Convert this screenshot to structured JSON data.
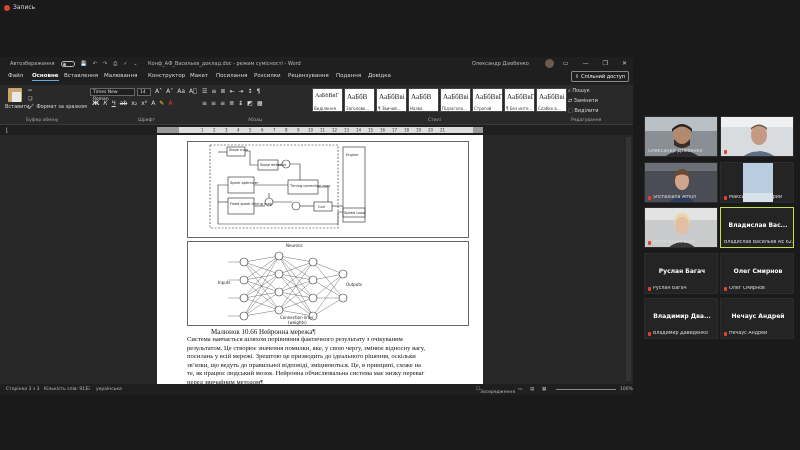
{
  "recording": {
    "label": "Запись"
  },
  "titlebar": {
    "autosave_label": "Автозбереження",
    "doc_title": "Конф_АФ_Васильєв_доклад.doc  -  режим сумісності  -  Word",
    "user": "Олександр Дзюбенко"
  },
  "tabs": [
    "Файл",
    "Основне",
    "Вставлення",
    "Малювання",
    "Конструктор",
    "Макет",
    "Посилання",
    "Розсилки",
    "Рецензування",
    "Подання",
    "Довідка"
  ],
  "active_tab": "Основне",
  "share_label": "Спільний доступ",
  "ribbon": {
    "paste_label": "Вставити",
    "format_painter": "Формат за зразком",
    "clipboard_group": "Буфер обміну",
    "font_name": "Times New Roman",
    "font_size": "14",
    "font_group": "Шрифт",
    "paragraph_group": "Абзац",
    "styles_group": "Стилі",
    "editing_group": "Редагування",
    "find": "Пошук",
    "replace": "Замінити",
    "select": "Виділити",
    "styles": [
      {
        "sample": "АаБбВвГ",
        "name": "Виділення"
      },
      {
        "sample": "АаБбВ",
        "name": "Заголово..."
      },
      {
        "sample": "АаБбВві",
        "name": "¶ Звичай..."
      },
      {
        "sample": "АаБбВ",
        "name": "Назва"
      },
      {
        "sample": "АаБбВві",
        "name": "Підзаголо..."
      },
      {
        "sample": "АаБбВвГ",
        "name": "Строгий"
      },
      {
        "sample": "АаБбВвГ",
        "name": "¶ Без инте..."
      },
      {
        "sample": "АаБбВві",
        "name": "Слабке в..."
      }
    ]
  },
  "figure2": {
    "neurons": "Neurons",
    "inputs": "Inputs",
    "outputs": "Outputs",
    "connection": "Connection lines",
    "weights": "(weights)"
  },
  "figure1": {
    "slope_map": "Slope map",
    "slope_detector": "Slope detector",
    "spark_map": "Spark optimizer",
    "fixed_spark": "Fixed spark timing map",
    "timing_map": "Timing correction map",
    "coil": "Coil",
    "engine": "Engine",
    "speed_load": "Speed Load"
  },
  "document": {
    "caption": "Малюнок 10.66 Нейронна мережа",
    "lines": [
      "     Система навчається шляхом порівняння фактичного результату з очікуваним",
      "результатом. Це створює значення помилки, яке, у свою чергу, змінює відносну вагу,",
      "посилань у всій мережі. Зрештою це призводить до ідеального рішення, оскільки",
      "зв’язки, що ведуть до правильної відповіді, зміцнюються. Це, в принципі, схоже на",
      "те, як працює людський мозок. Нейронна обчислювальна система має низку переваг",
      "перед звичайним методом"
    ]
  },
  "statusbar": {
    "page": "Сторінка 3 з 3",
    "words": "Кількість слів: 911",
    "language": "українська",
    "focus": "Зосередження",
    "zoom": "100%"
  },
  "participants": [
    {
      "name": "Олександр Дзюбенко",
      "muted": false,
      "video": true,
      "photo": "man-dark"
    },
    {
      "name": "ӘԹԿՃ ԶԽԾԲ ԹՔԽԽՃՆԽ",
      "muted": true,
      "video": true,
      "photo": "man-light"
    },
    {
      "name": "Shchasiana Arhuh",
      "muted": true,
      "video": true,
      "photo": "woman"
    },
    {
      "name": "Максим Товстокорий",
      "muted": true,
      "video": true,
      "photo": "sky"
    },
    {
      "name": "АННА Борисенко",
      "muted": true,
      "video": true,
      "photo": "woman2"
    },
    {
      "name": "Владислав Васильев АЕ 62...",
      "title": "Владислав  Вас...",
      "muted": false,
      "video": false,
      "active": true
    },
    {
      "name": "Руслан Багач",
      "title": "Руслан Багач",
      "muted": true,
      "video": false
    },
    {
      "name": "Олег Смирнов",
      "title": "Олег Смирнов",
      "muted": true,
      "video": false
    },
    {
      "name": "Владимир Давиденко",
      "title": "Владимир  Два...",
      "muted": true,
      "video": false
    },
    {
      "name": "Нечаус Андрей",
      "title": "Нечаус Андрей",
      "muted": true,
      "video": false
    }
  ]
}
